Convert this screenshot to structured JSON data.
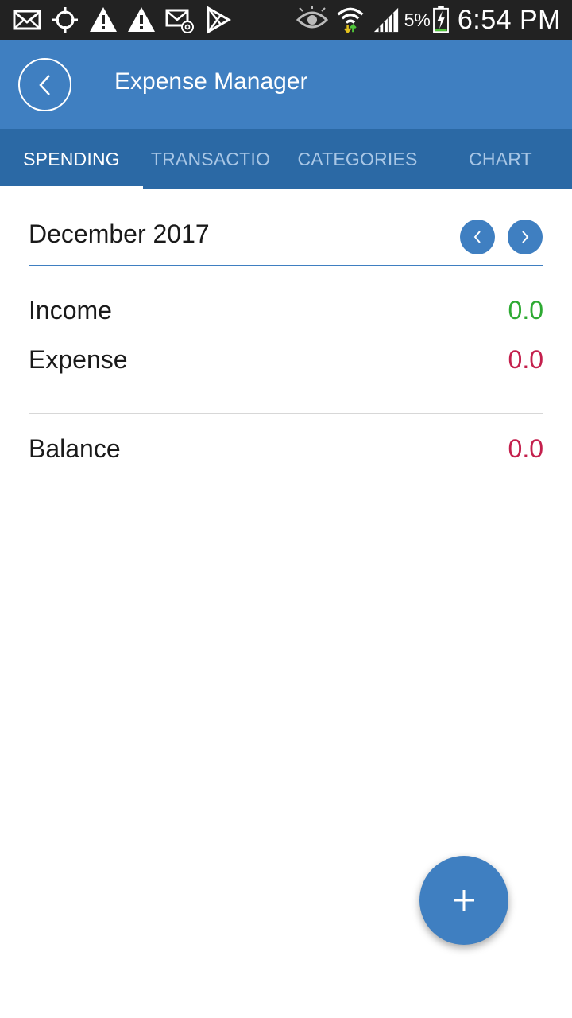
{
  "status_bar": {
    "battery_percent": "5%",
    "time": "6:54 PM"
  },
  "app_bar": {
    "title": "Expense Manager"
  },
  "tabs": [
    {
      "label": "SPENDING",
      "active": true
    },
    {
      "label": "TRANSACTIO",
      "active": false
    },
    {
      "label": "CATEGORIES",
      "active": false
    },
    {
      "label": "CHART",
      "active": false
    }
  ],
  "summary": {
    "month": "December 2017",
    "income_label": "Income",
    "income_value": "0.0",
    "expense_label": "Expense",
    "expense_value": "0.0",
    "balance_label": "Balance",
    "balance_value": "0.0"
  },
  "colors": {
    "primary": "#3f7fc1",
    "tab_bar": "#2b69a5",
    "income": "#2eaa33",
    "expense": "#c4204d",
    "balance": "#c4204d"
  },
  "icons": {
    "back": "chevron-left-icon",
    "prev_month": "chevron-left-icon",
    "next_month": "chevron-right-icon",
    "fab": "plus-icon"
  }
}
